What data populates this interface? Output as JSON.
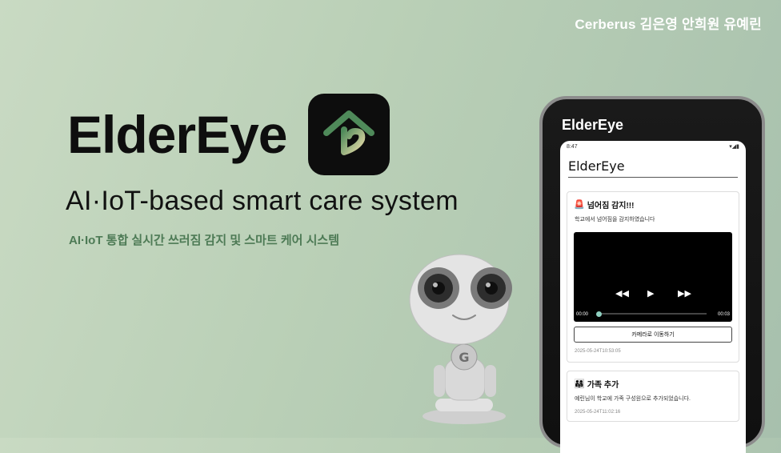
{
  "header": {
    "team": "Cerberus 김은영 안희원 유예린"
  },
  "hero": {
    "title": "ElderEye",
    "subtitle": "AI·IoT-based smart care system",
    "korean_subtitle": "AI·IoT 통합 실시간 쓰러짐 감지 및 스마트 케어 시스템"
  },
  "phone": {
    "label": "ElderEye",
    "status_time": "8:47",
    "app_title": "ElderEye",
    "notifications": [
      {
        "icon": "alarm-icon",
        "title": "넘어짐 감지!!!",
        "message": "학교에서 넘어짐을 감지하였습니다",
        "video": {
          "time_current": "00:00",
          "time_total": "00:03"
        },
        "button_label": "카메라로 이동하기",
        "timestamp": "2025-05-24T10:53:05"
      },
      {
        "icon": "family-icon",
        "title": "가족 추가",
        "message": "예린님이 학교에 가족 구성원으로 추가되었습니다.",
        "timestamp": "2025-05-24T11:02:16"
      }
    ]
  },
  "colors": {
    "accent_green": "#4d7a55",
    "background": "#b9cfb6",
    "video_progress": "#8fd0c0"
  }
}
